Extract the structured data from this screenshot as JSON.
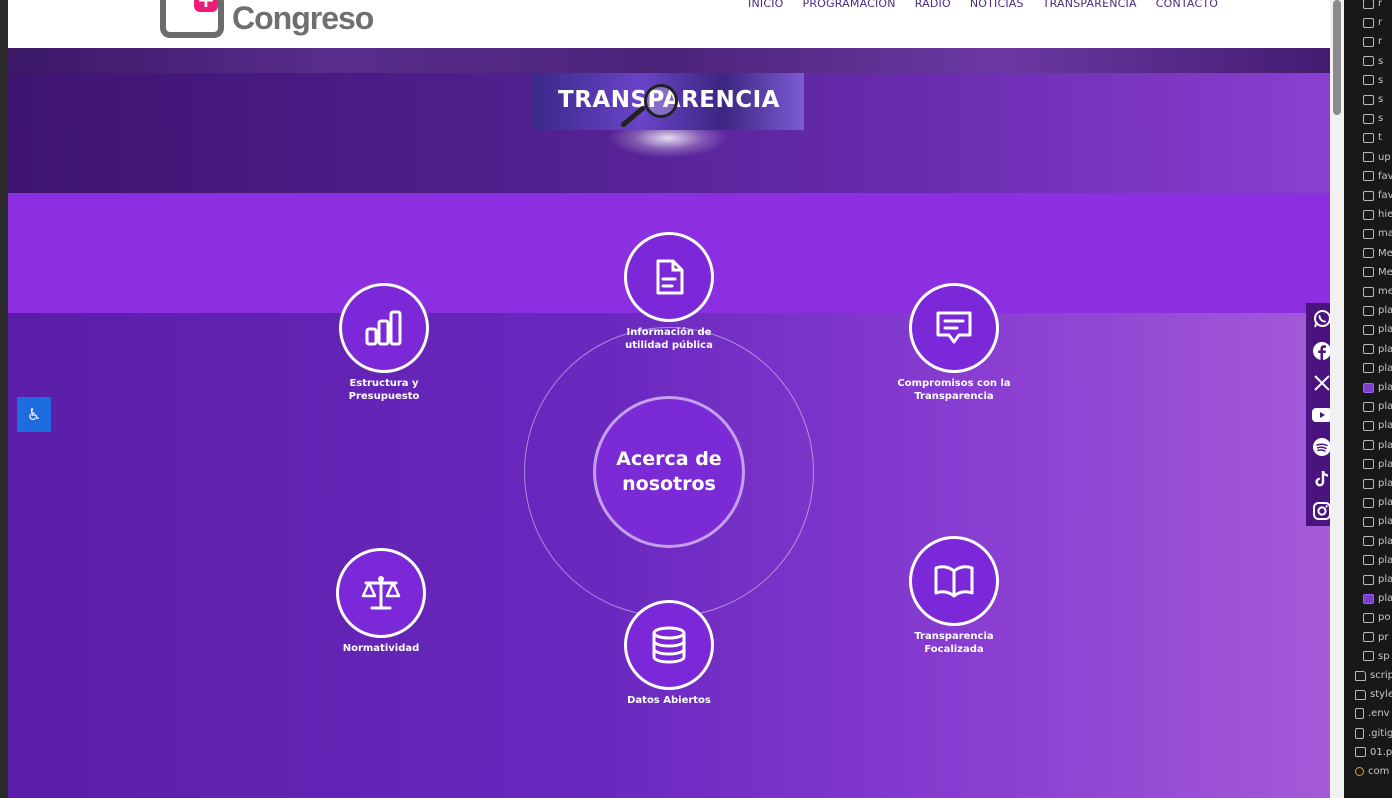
{
  "header": {
    "logo_text": "Congreso",
    "logo_plus": "+",
    "nav": [
      "INICIO",
      "PROGRAMACIÓN",
      "RADIO",
      "NOTICIAS",
      "TRANSPARENCIA",
      "CONTACTO"
    ]
  },
  "banner": {
    "title": "TRANSPARENCIA",
    "icon": "magnifying-glass-icon"
  },
  "center": {
    "label": "Acerca de nosotros"
  },
  "nodes": [
    {
      "label": "Información de\nutilidad pública",
      "icon": "document-icon"
    },
    {
      "label": "Estructura y\nPresupuesto",
      "icon": "bar-chart-icon"
    },
    {
      "label": "Compromisos con la\nTransparencia",
      "icon": "message-icon"
    },
    {
      "label": "Normatividad",
      "icon": "scales-icon"
    },
    {
      "label": "Transparencia\nFocalizada",
      "icon": "open-book-icon"
    },
    {
      "label": "Datos Abiertos",
      "icon": "database-icon"
    }
  ],
  "accessibility": {
    "icon": "accessibility-icon"
  },
  "social": [
    "whatsapp-icon",
    "facebook-icon",
    "x-icon",
    "youtube-icon",
    "spotify-icon",
    "tiktok-icon",
    "instagram-icon"
  ],
  "explorer": {
    "items": [
      {
        "type": "image",
        "text": "r"
      },
      {
        "type": "image",
        "text": "r"
      },
      {
        "type": "image",
        "text": "r"
      },
      {
        "type": "image",
        "text": "s"
      },
      {
        "type": "image",
        "text": "s"
      },
      {
        "type": "image",
        "text": "s"
      },
      {
        "type": "image",
        "text": "s"
      },
      {
        "type": "image",
        "text": "t"
      },
      {
        "type": "folder",
        "text": "up"
      },
      {
        "type": "image",
        "text": "fav"
      },
      {
        "type": "image",
        "text": "fav"
      },
      {
        "type": "image",
        "text": "hie"
      },
      {
        "type": "image",
        "text": "ma"
      },
      {
        "type": "image",
        "text": "Me"
      },
      {
        "type": "image",
        "text": "Me"
      },
      {
        "type": "image",
        "text": "me"
      },
      {
        "type": "image",
        "text": "pla"
      },
      {
        "type": "image",
        "text": "pla"
      },
      {
        "type": "image",
        "text": "pla"
      },
      {
        "type": "image",
        "text": "pla"
      },
      {
        "type": "purple",
        "text": "pla"
      },
      {
        "type": "image",
        "text": "pla"
      },
      {
        "type": "image",
        "text": "pla"
      },
      {
        "type": "image",
        "text": "pla"
      },
      {
        "type": "image",
        "text": "pla"
      },
      {
        "type": "image",
        "text": "pla"
      },
      {
        "type": "image",
        "text": "pla"
      },
      {
        "type": "image",
        "text": "pla"
      },
      {
        "type": "image",
        "text": "pla"
      },
      {
        "type": "image",
        "text": "pla"
      },
      {
        "type": "image",
        "text": "pla"
      },
      {
        "type": "purple",
        "text": "pla"
      },
      {
        "type": "image",
        "text": "po"
      },
      {
        "type": "image",
        "text": "pr"
      },
      {
        "type": "image",
        "text": "sp"
      },
      {
        "type": "folder",
        "text": "scrip"
      },
      {
        "type": "folder",
        "text": "style"
      },
      {
        "type": "file",
        "text": ".env"
      },
      {
        "type": "file",
        "text": ".gitig"
      },
      {
        "type": "image",
        "text": "01.p"
      },
      {
        "type": "yellow",
        "text": "com"
      }
    ]
  },
  "colors": {
    "header_bg": "#ffffff",
    "page_purple": "#8b2fe0",
    "accent_blue": "#1d6ce0",
    "nav_text": "#4b2a7b"
  }
}
